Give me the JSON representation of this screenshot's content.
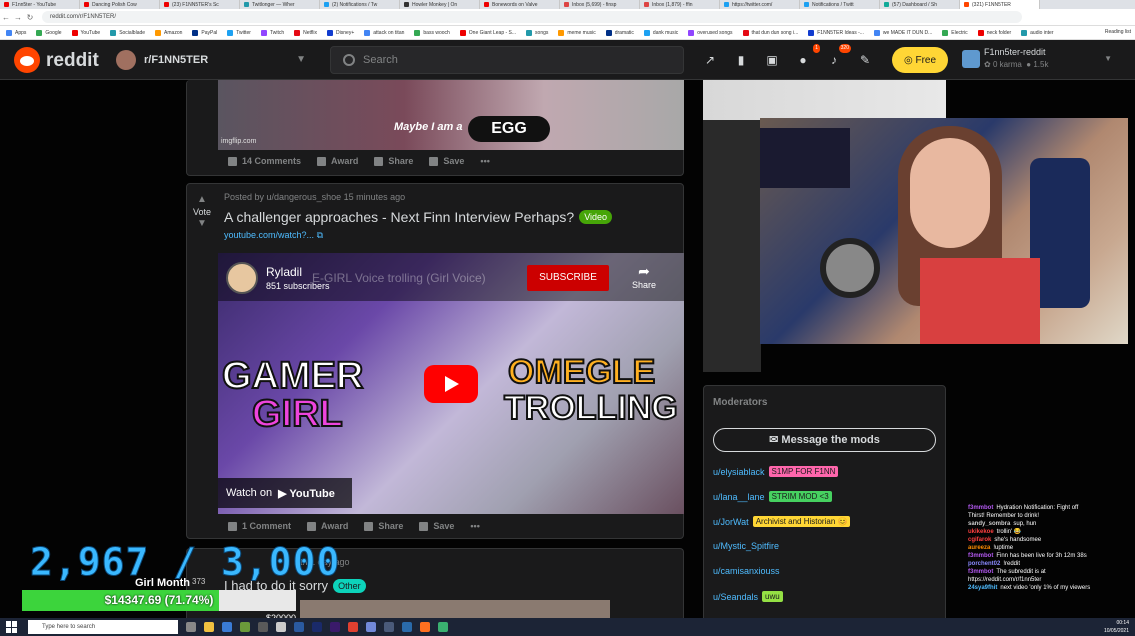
{
  "browser": {
    "tabs": [
      "F1nn5ter - YouTube",
      "Dancing Polish Cow",
      "(23) F1NN5TER's Sc",
      "Twitlonger — Wher",
      "(2) Notifications / Tw",
      "Howler Monkey | On",
      "Bonewords on Valve",
      "Inbox (5,699) - finsp",
      "Inbox (1,879) - ffin",
      "https://twitter.com/",
      "Notifications / Twitt",
      "(57) Dashboard / Sh",
      "(321) F1NN5TER"
    ],
    "url": "reddit.com/r/F1NN5TER/",
    "bookmarks": [
      "Apps",
      "Google",
      "YouTube",
      "Socialblade",
      "Amazon",
      "PayPal",
      "Twitter",
      "Twitch",
      "Netflix",
      "Disney+",
      "attack on titan",
      "bass wooch",
      "One Giant Leap - S...",
      "songs",
      "meme music",
      "dramatic",
      "dank music",
      "overused songs",
      "that dun dun song i...",
      "F1NN5TER Ideas -...",
      "we MADE IT DUN D...",
      "Electric",
      "neck folder",
      "audio inter"
    ],
    "reading_list": "Reading list"
  },
  "header": {
    "brand": "reddit",
    "subreddit": "r/F1NN5TER",
    "search_placeholder": "Search",
    "chat_badge": "1",
    "notif_badge": "320",
    "free_label": "Free",
    "username": "F1nn5ter-reddit",
    "karma": "0 karma",
    "coins": "1.5k"
  },
  "prev_post": {
    "meme_text": "Maybe I am a",
    "meme_egg": "EGG",
    "meme_source": "imgflip.com",
    "comments": "14 Comments",
    "award": "Award",
    "share": "Share",
    "save": "Save"
  },
  "post": {
    "vote": "Vote",
    "posted_by": "Posted by u/dangerous_shoe 15 minutes ago",
    "title": "A challenger approaches - Next Finn Interview Perhaps?",
    "flair": "Video",
    "link": "youtube.com/watch?...",
    "channel_name": "Ryladil",
    "channel_subs": "851 subscribers",
    "video_title": "E-GIRL Voice trolling (Girl Voice)",
    "subscribe": "SUBSCRIBE",
    "share_label": "Share",
    "thumb_line1": "GAMER",
    "thumb_line2": "GIRL",
    "thumb_line3": "OMEGLE",
    "thumb_line4": "TROLLING",
    "watch_on": "Watch on",
    "youtube": "YouTube",
    "comments": "1 Comment",
    "award": "Award",
    "share": "Share",
    "save": "Save"
  },
  "next_post": {
    "meta": "th 1 day ago",
    "title": "I had to do it sorry",
    "flair": "Other"
  },
  "overlay": {
    "counter": "2,967 / 3,000",
    "month_label": "Girl Month",
    "month_small": "373",
    "progress_text": "$14347.69 (71.74%)",
    "progress_fraction": 0.7174,
    "goal": "$20000"
  },
  "moderators": {
    "heading": "Moderators",
    "message_button": "Message the mods",
    "list": [
      {
        "name": "u/elysiablack",
        "flair": "S1MP FOR F1NN",
        "color": "#ff66ac"
      },
      {
        "name": "u/lana__lane",
        "flair": "STRIM MOD <3",
        "color": "#46d160"
      },
      {
        "name": "u/JorWat",
        "flair": "Archivist and Historian 😊",
        "color": "#ffd635"
      },
      {
        "name": "u/Mystic_Spitfire",
        "flair": "",
        "color": ""
      },
      {
        "name": "u/camisanxiouss",
        "flair": "",
        "color": ""
      },
      {
        "name": "u/Seandals",
        "flair": "uwu",
        "color": "#94e044"
      }
    ]
  },
  "chat": [
    {
      "user": "f3mmbot",
      "color": "#b45af2",
      "msg": "Hydration Notification: Fight off"
    },
    {
      "user": "",
      "color": "#fff",
      "msg": "Thirst! Remember to drink!"
    },
    {
      "user": "sandy_sombra",
      "color": "#ccc",
      "msg": "sup, hun"
    },
    {
      "user": "ukikekoe",
      "color": "#ff4040",
      "msg": "trollin' 😂"
    },
    {
      "user": "cgifarok",
      "color": "#ff4040",
      "msg": "she's handsomee"
    },
    {
      "user": "aureeza",
      "color": "#ff8c00",
      "msg": "!uptime"
    },
    {
      "user": "f3mmbot",
      "color": "#b45af2",
      "msg": "Finn has been live for 3h 12m 38s"
    },
    {
      "user": "porchent02",
      "color": "#8a8aff",
      "msg": "!reddit"
    },
    {
      "user": "f3mmbot",
      "color": "#b45af2",
      "msg": "The subreddit is at"
    },
    {
      "user": "",
      "color": "#fff",
      "msg": "https://reddit.com/r/f1nn5ter"
    },
    {
      "user": "24sya9fhit",
      "color": "#4fbcff",
      "msg": "next video 'only 1% of my viewers"
    }
  ],
  "taskbar": {
    "search_placeholder": "Type here to search",
    "time": "00:14",
    "date": "10/05/2021"
  }
}
